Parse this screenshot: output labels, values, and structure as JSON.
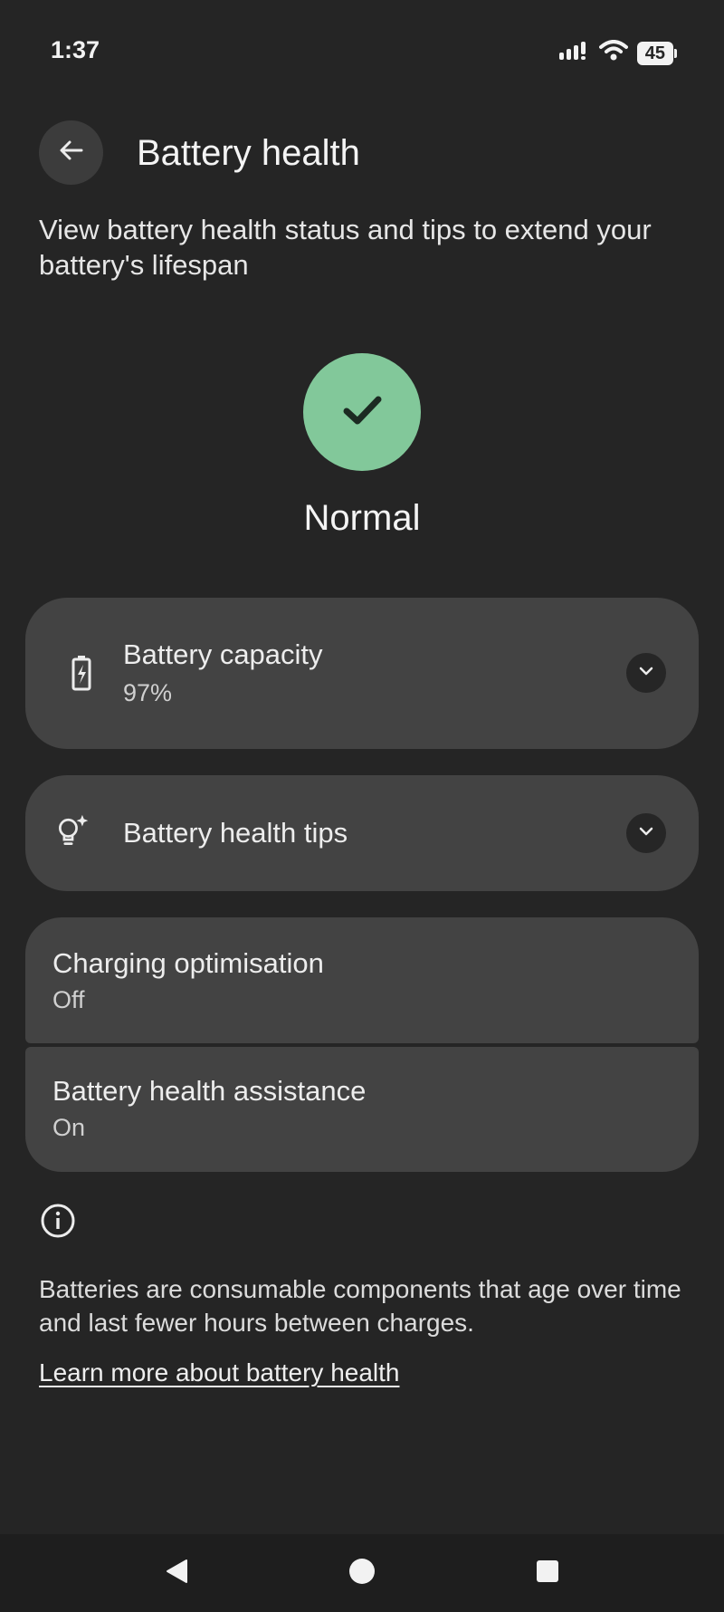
{
  "status_bar": {
    "time": "1:37",
    "battery_level": "45",
    "icons": [
      "signal-icon",
      "wifi-icon",
      "battery-icon"
    ]
  },
  "header": {
    "title": "Battery health",
    "subtitle": "View battery health status and tips to extend your battery's lifespan"
  },
  "health_status": {
    "label": "Normal",
    "icon": "check-icon",
    "color": "#82c89a"
  },
  "cards": {
    "capacity": {
      "title": "Battery capacity",
      "value": "97%",
      "icon": "battery-charging-icon"
    },
    "tips": {
      "title": "Battery health tips",
      "icon": "lightbulb-sparkle-icon"
    },
    "charging": {
      "title": "Charging optimisation",
      "value": "Off"
    },
    "assistance": {
      "title": "Battery health assistance",
      "value": "On"
    }
  },
  "footer": {
    "info_text": "Batteries are consumable components that age over time and last fewer hours between charges.",
    "link": "Learn more about battery health"
  },
  "nav": {
    "buttons": [
      "back-icon",
      "home-icon",
      "recents-icon"
    ]
  }
}
